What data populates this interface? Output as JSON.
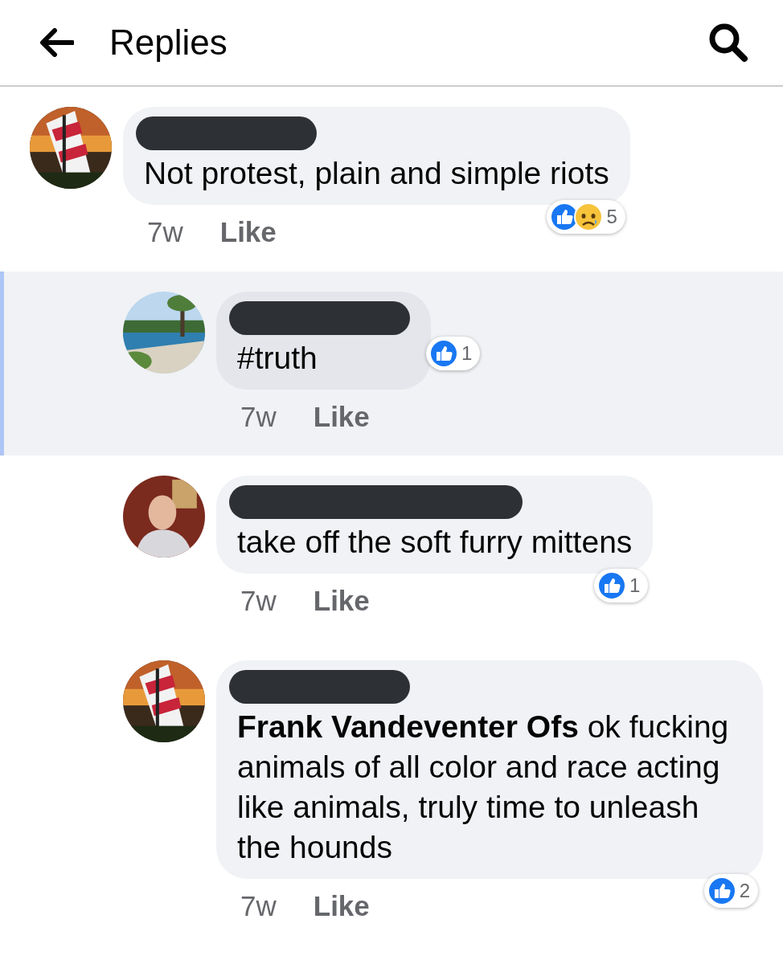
{
  "header": {
    "title": "Replies"
  },
  "comment": {
    "name_redacted": true,
    "text": "Not protest, plain and simple riots",
    "time": "7w",
    "action": "Like",
    "reactions": {
      "like": true,
      "sad": true,
      "count": "5"
    },
    "replies": [
      {
        "name_redacted": true,
        "highlighted": true,
        "text": "#truth",
        "time": "7w",
        "action": "Like",
        "reactions": {
          "like": true,
          "count": "1"
        }
      },
      {
        "name_redacted": true,
        "highlighted": false,
        "text": "take off the soft furry mittens",
        "time": "7w",
        "action": "Like",
        "reactions": {
          "like": true,
          "count": "1"
        }
      },
      {
        "name_redacted": true,
        "highlighted": false,
        "text": "**Frank Vandeventer Ofs** ok fucking animals of all color and race acting like animals, truly time to unleash the hounds",
        "time": "7w",
        "action": "Like",
        "reactions": {
          "like": true,
          "count": "2"
        }
      }
    ]
  }
}
